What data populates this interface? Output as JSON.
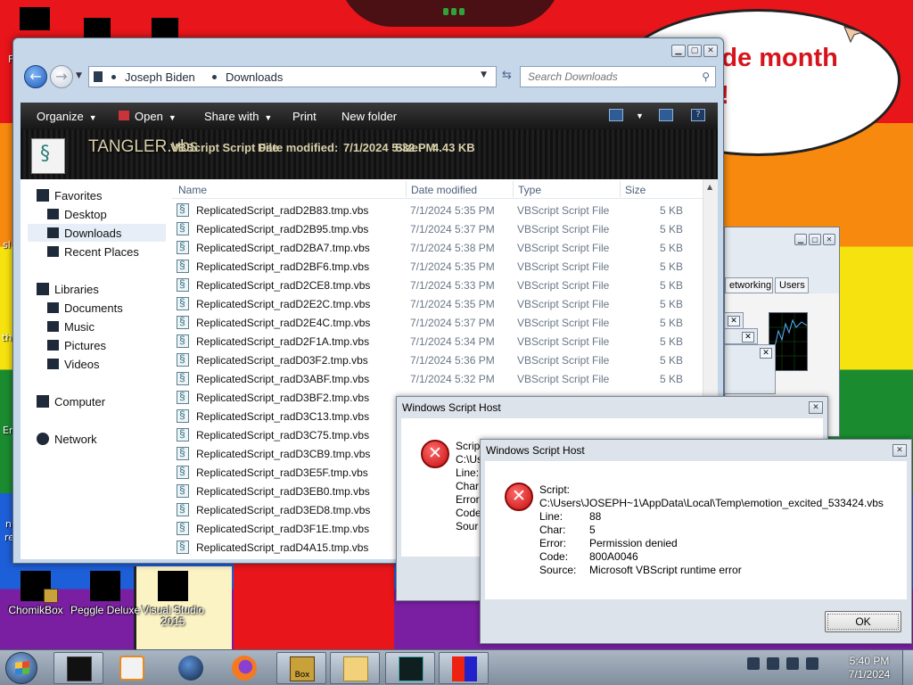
{
  "desktop": {
    "bubble_text_line1": "ride month",
    "bubble_text_line2": "e!",
    "icons": [
      {
        "label": "ChomikBox"
      },
      {
        "label": "Peggle Deluxe"
      },
      {
        "label": "Visual Studio 2015"
      }
    ],
    "left_edge_texts": [
      "F",
      "sl",
      "th",
      "Er",
      "n",
      "re"
    ]
  },
  "explorer": {
    "breadcrumb": [
      "Joseph Biden",
      "Downloads"
    ],
    "search_placeholder": "Search Downloads",
    "toolbar": {
      "organize": "Organize",
      "open": "Open",
      "share_with": "Share with",
      "print": "Print",
      "new_folder": "New folder"
    },
    "preview": {
      "name_garbled": "TANGLER.vbs",
      "type_text": "VBScript Script File",
      "date_label": "Date modified:",
      "date_value": "7/1/2024 5:32 PM",
      "size_label": "Size:",
      "size_value": "4.43 KB"
    },
    "nav": {
      "favorites": "Favorites",
      "desktop": "Desktop",
      "downloads": "Downloads",
      "recent_places": "Recent Places",
      "libraries": "Libraries",
      "documents": "Documents",
      "music": "Music",
      "pictures": "Pictures",
      "videos": "Videos",
      "computer": "Computer",
      "network": "Network"
    },
    "columns": {
      "name": "Name",
      "date": "Date modified",
      "type": "Type",
      "size": "Size"
    },
    "files": [
      {
        "name": "ReplicatedScript_radD2B83.tmp.vbs",
        "date": "7/1/2024 5:35 PM",
        "type": "VBScript Script File",
        "size": "5 KB"
      },
      {
        "name": "ReplicatedScript_radD2B95.tmp.vbs",
        "date": "7/1/2024 5:37 PM",
        "type": "VBScript Script File",
        "size": "5 KB"
      },
      {
        "name": "ReplicatedScript_radD2BA7.tmp.vbs",
        "date": "7/1/2024 5:38 PM",
        "type": "VBScript Script File",
        "size": "5 KB"
      },
      {
        "name": "ReplicatedScript_radD2BF6.tmp.vbs",
        "date": "7/1/2024 5:35 PM",
        "type": "VBScript Script File",
        "size": "5 KB"
      },
      {
        "name": "ReplicatedScript_radD2CE8.tmp.vbs",
        "date": "7/1/2024 5:33 PM",
        "type": "VBScript Script File",
        "size": "5 KB"
      },
      {
        "name": "ReplicatedScript_radD2E2C.tmp.vbs",
        "date": "7/1/2024 5:35 PM",
        "type": "VBScript Script File",
        "size": "5 KB"
      },
      {
        "name": "ReplicatedScript_radD2E4C.tmp.vbs",
        "date": "7/1/2024 5:37 PM",
        "type": "VBScript Script File",
        "size": "5 KB"
      },
      {
        "name": "ReplicatedScript_radD2F1A.tmp.vbs",
        "date": "7/1/2024 5:34 PM",
        "type": "VBScript Script File",
        "size": "5 KB"
      },
      {
        "name": "ReplicatedScript_radD03F2.tmp.vbs",
        "date": "7/1/2024 5:36 PM",
        "type": "VBScript Script File",
        "size": "5 KB"
      },
      {
        "name": "ReplicatedScript_radD3ABF.tmp.vbs",
        "date": "7/1/2024 5:32 PM",
        "type": "VBScript Script File",
        "size": "5 KB"
      },
      {
        "name": "ReplicatedScript_radD3BF2.tmp.vbs",
        "date": "",
        "type": "",
        "size": ""
      },
      {
        "name": "ReplicatedScript_radD3C13.tmp.vbs",
        "date": "",
        "type": "",
        "size": ""
      },
      {
        "name": "ReplicatedScript_radD3C75.tmp.vbs",
        "date": "",
        "type": "",
        "size": ""
      },
      {
        "name": "ReplicatedScript_radD3CB9.tmp.vbs",
        "date": "",
        "type": "",
        "size": ""
      },
      {
        "name": "ReplicatedScript_radD3E5F.tmp.vbs",
        "date": "",
        "type": "",
        "size": ""
      },
      {
        "name": "ReplicatedScript_radD3EB0.tmp.vbs",
        "date": "",
        "type": "",
        "size": ""
      },
      {
        "name": "ReplicatedScript_radD3ED8.tmp.vbs",
        "date": "",
        "type": "",
        "size": ""
      },
      {
        "name": "ReplicatedScript_radD3F1E.tmp.vbs",
        "date": "",
        "type": "",
        "size": ""
      },
      {
        "name": "ReplicatedScript_radD4A15.tmp.vbs",
        "date": "",
        "type": "",
        "size": ""
      }
    ]
  },
  "task_manager": {
    "tabs": [
      "etworking",
      "Users"
    ]
  },
  "dialog_back": {
    "title": "Windows Script Host",
    "labels": [
      "Scrip",
      "C:\\Us",
      "Line:",
      "Char",
      "Error",
      "Code",
      "Sour"
    ]
  },
  "dialog_front": {
    "title": "Windows Script Host",
    "script_label": "Script:",
    "script_path": "C:\\Users\\JOSEPH~1\\AppData\\Local\\Temp\\emotion_excited_533424.vbs",
    "line_label": "Line:",
    "line_value": "88",
    "char_label": "Char:",
    "char_value": "5",
    "error_label": "Error:",
    "error_value": "Permission denied",
    "code_label": "Code:",
    "code_value": "800A0046",
    "source_label": "Source:",
    "source_value": "Microsoft VBScript runtime error",
    "ok_label": "OK"
  },
  "taskbar": {
    "time": "5:40 PM",
    "date": "7/1/2024",
    "box_label": "Box"
  },
  "colors": {
    "accent_red": "#e8151a",
    "error_red": "#c50f0f"
  }
}
